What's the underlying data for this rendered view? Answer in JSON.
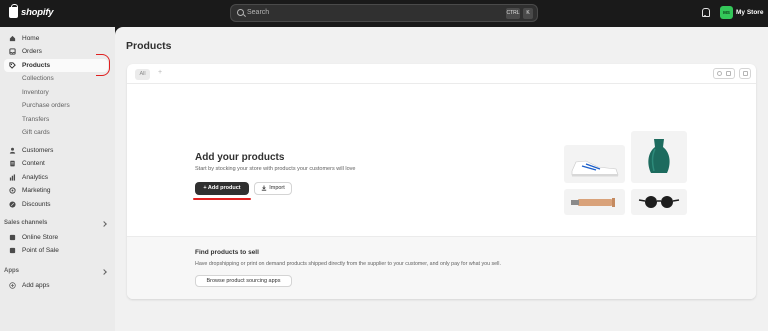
{
  "topbar": {
    "logo_text": "shopify",
    "search_placeholder": "Search",
    "shortcut_keys": [
      "CTRL",
      "K"
    ],
    "avatar_initials": "MS",
    "store_name": "My Store"
  },
  "sidebar": {
    "items": [
      {
        "label": "Home",
        "icon": "home-icon"
      },
      {
        "label": "Orders",
        "icon": "inbox-icon"
      },
      {
        "label": "Products",
        "icon": "tag-icon",
        "active": true
      },
      {
        "label": "Collections",
        "sub": true
      },
      {
        "label": "Inventory",
        "sub": true
      },
      {
        "label": "Purchase orders",
        "sub": true
      },
      {
        "label": "Transfers",
        "sub": true
      },
      {
        "label": "Gift cards",
        "sub": true
      },
      {
        "label": "Customers",
        "icon": "person-icon"
      },
      {
        "label": "Content",
        "icon": "document-icon"
      },
      {
        "label": "Analytics",
        "icon": "chart-icon"
      },
      {
        "label": "Marketing",
        "icon": "target-icon"
      },
      {
        "label": "Discounts",
        "icon": "discount-icon"
      }
    ],
    "sales_channels_label": "Sales channels",
    "channels": [
      {
        "label": "Online Store",
        "icon": "store-icon"
      },
      {
        "label": "Point of Sale",
        "icon": "pos-icon"
      }
    ],
    "apps_label": "Apps",
    "add_apps_label": "Add apps"
  },
  "main": {
    "page_title": "Products",
    "filter_tab": "All",
    "add_view": "+",
    "empty_state": {
      "title": "Add your products",
      "description": "Start by stocking your store with products your customers will love",
      "primary_button": "Add product",
      "secondary_button": "Import"
    },
    "sourcing": {
      "title": "Find products to sell",
      "description": "Have dropshipping or print on demand products shipped directly from the supplier to your customer, and only pay for what you sell.",
      "button": "Browse product sourcing apps"
    }
  },
  "colors": {
    "topbar_bg": "#1a1a1a",
    "sidebar_bg": "#ebebeb",
    "main_bg": "#f1f1f1",
    "primary_button_bg": "#303030",
    "avatar_bg": "#34c759",
    "annotation_red": "#e02020"
  }
}
